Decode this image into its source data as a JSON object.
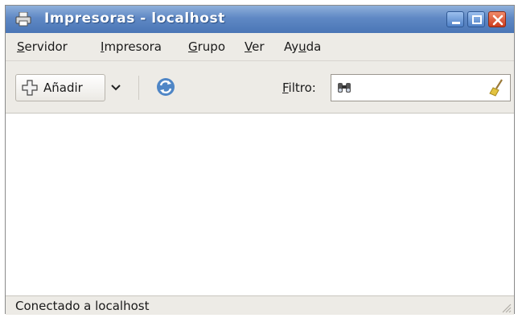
{
  "window": {
    "title": "Impresoras - localhost",
    "colors": {
      "titlebar": "#5f88c4",
      "close_button": "#cc3b1d",
      "window_bg": "#edebe6"
    }
  },
  "titlebar": {
    "icon": "printer-icon",
    "buttons": [
      "minimize-icon",
      "maximize-icon",
      "close-icon"
    ]
  },
  "menubar": {
    "items": [
      {
        "label": "Servidor",
        "accel": "S",
        "rest": "ervidor"
      },
      {
        "label": "Impresora",
        "accel": "I",
        "rest": "mpresora"
      },
      {
        "label": "Grupo",
        "accel": "G",
        "rest": "rupo"
      },
      {
        "label": "Ver",
        "accel": "V",
        "rest": "er"
      },
      {
        "label": "Ayuda",
        "pre": "Ay",
        "accel": "u",
        "rest": "da"
      }
    ]
  },
  "toolbar": {
    "add_label": "Añadir",
    "add_icon": "plus-icon",
    "dropdown_icon": "chevron-down-icon",
    "refresh_icon": "refresh-icon",
    "filter": {
      "accel": "F",
      "rest": "iltro:",
      "label": "Filtro:",
      "value": "",
      "search_icon": "binoculars-icon",
      "clear_icon": "broom-clear-icon"
    }
  },
  "status": {
    "text": "Conectado a localhost"
  }
}
